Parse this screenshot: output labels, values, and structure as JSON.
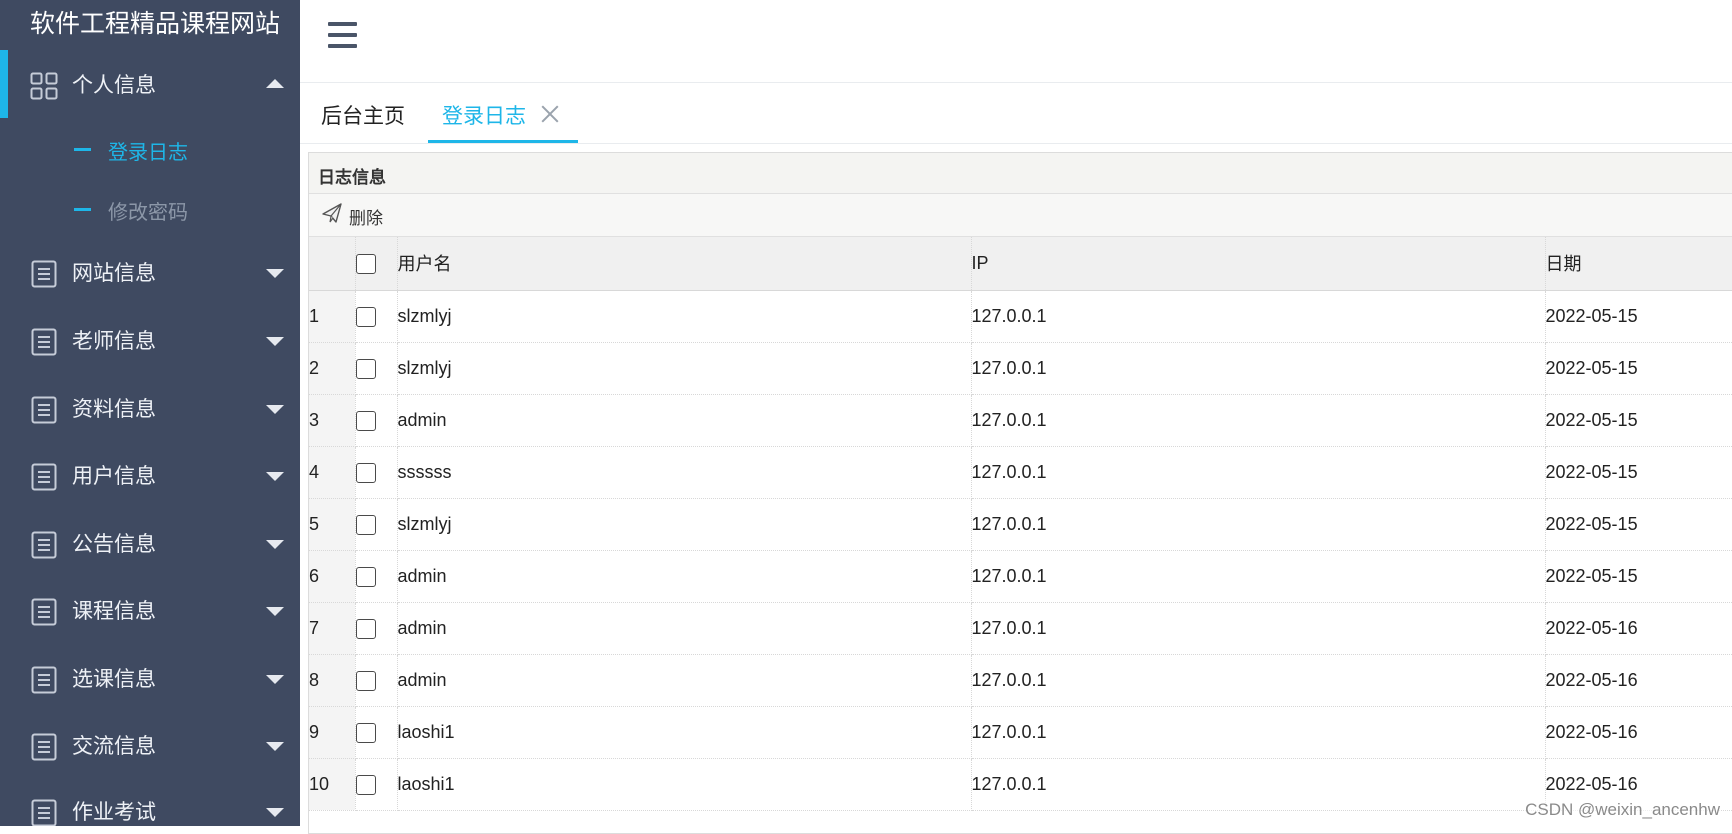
{
  "brand": {
    "title": "软件工程精品课程网站"
  },
  "sidebar": {
    "items": [
      {
        "label": "个人信息",
        "icon": "grid-icon",
        "expanded": true,
        "children": [
          {
            "label": "登录日志",
            "active": true
          },
          {
            "label": "修改密码",
            "active": false
          }
        ]
      },
      {
        "label": "网站信息",
        "icon": "document-icon",
        "expanded": false
      },
      {
        "label": "老师信息",
        "icon": "document-icon",
        "expanded": false
      },
      {
        "label": "资料信息",
        "icon": "document-icon",
        "expanded": false
      },
      {
        "label": "用户信息",
        "icon": "document-icon",
        "expanded": false
      },
      {
        "label": "公告信息",
        "icon": "document-icon",
        "expanded": false
      },
      {
        "label": "课程信息",
        "icon": "document-icon",
        "expanded": false
      },
      {
        "label": "选课信息",
        "icon": "document-icon",
        "expanded": false
      },
      {
        "label": "交流信息",
        "icon": "document-icon",
        "expanded": false
      },
      {
        "label": "作业考试",
        "icon": "document-icon",
        "expanded": false
      }
    ]
  },
  "tabs": [
    {
      "label": "后台主页",
      "active": false
    },
    {
      "label": "登录日志",
      "active": true,
      "closable": true
    }
  ],
  "panel": {
    "title": "日志信息",
    "toolbar": {
      "delete_label": "删除",
      "delete_icon": "paper-plane-icon"
    }
  },
  "table": {
    "columns": {
      "username": "用户名",
      "ip": "IP",
      "date": "日期"
    },
    "rows": [
      {
        "n": "1",
        "username": "slzmlyj",
        "ip": "127.0.0.1",
        "date": "2022-05-15"
      },
      {
        "n": "2",
        "username": "slzmlyj",
        "ip": "127.0.0.1",
        "date": "2022-05-15"
      },
      {
        "n": "3",
        "username": "admin",
        "ip": "127.0.0.1",
        "date": "2022-05-15"
      },
      {
        "n": "4",
        "username": "ssssss",
        "ip": "127.0.0.1",
        "date": "2022-05-15"
      },
      {
        "n": "5",
        "username": "slzmlyj",
        "ip": "127.0.0.1",
        "date": "2022-05-15"
      },
      {
        "n": "6",
        "username": "admin",
        "ip": "127.0.0.1",
        "date": "2022-05-15"
      },
      {
        "n": "7",
        "username": "admin",
        "ip": "127.0.0.1",
        "date": "2022-05-16"
      },
      {
        "n": "8",
        "username": "admin",
        "ip": "127.0.0.1",
        "date": "2022-05-16"
      },
      {
        "n": "9",
        "username": "laoshi1",
        "ip": "127.0.0.1",
        "date": "2022-05-16"
      },
      {
        "n": "10",
        "username": "laoshi1",
        "ip": "127.0.0.1",
        "date": "2022-05-16"
      }
    ]
  },
  "watermark": "CSDN @weixin_ancenhw",
  "colors": {
    "sidebar_bg": "#3f4a61",
    "accent": "#1eb6e8"
  }
}
